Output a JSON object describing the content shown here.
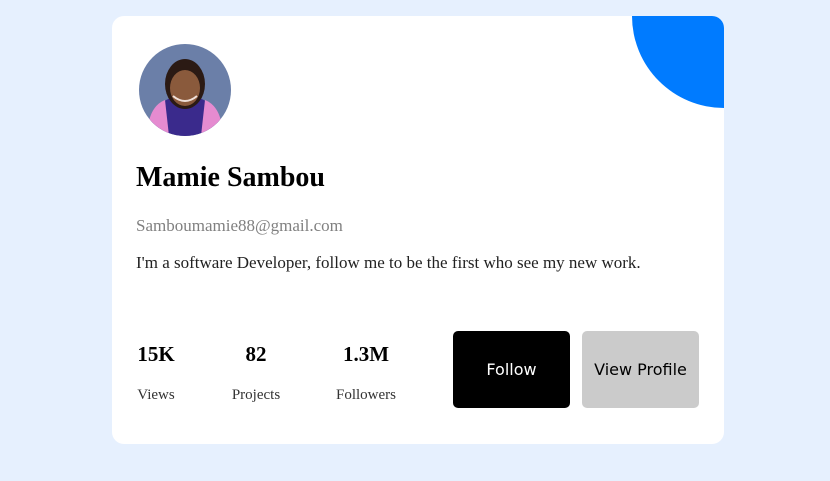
{
  "profile": {
    "name": "Mamie Sambou",
    "email": "Samboumamie88@gmail.com",
    "bio": "I'm a software Developer, follow me to be the first who see my new work."
  },
  "stats": [
    {
      "value": "15K",
      "label": "Views"
    },
    {
      "value": "82",
      "label": "Projects"
    },
    {
      "value": "1.3M",
      "label": "Followers"
    }
  ],
  "actions": {
    "follow_label": "Follow",
    "view_profile_label": "View Profile"
  },
  "colors": {
    "background": "#e6f0fe",
    "accent": "#007bff",
    "follow_button": "#000000",
    "view_button": "#cbcbcb"
  }
}
